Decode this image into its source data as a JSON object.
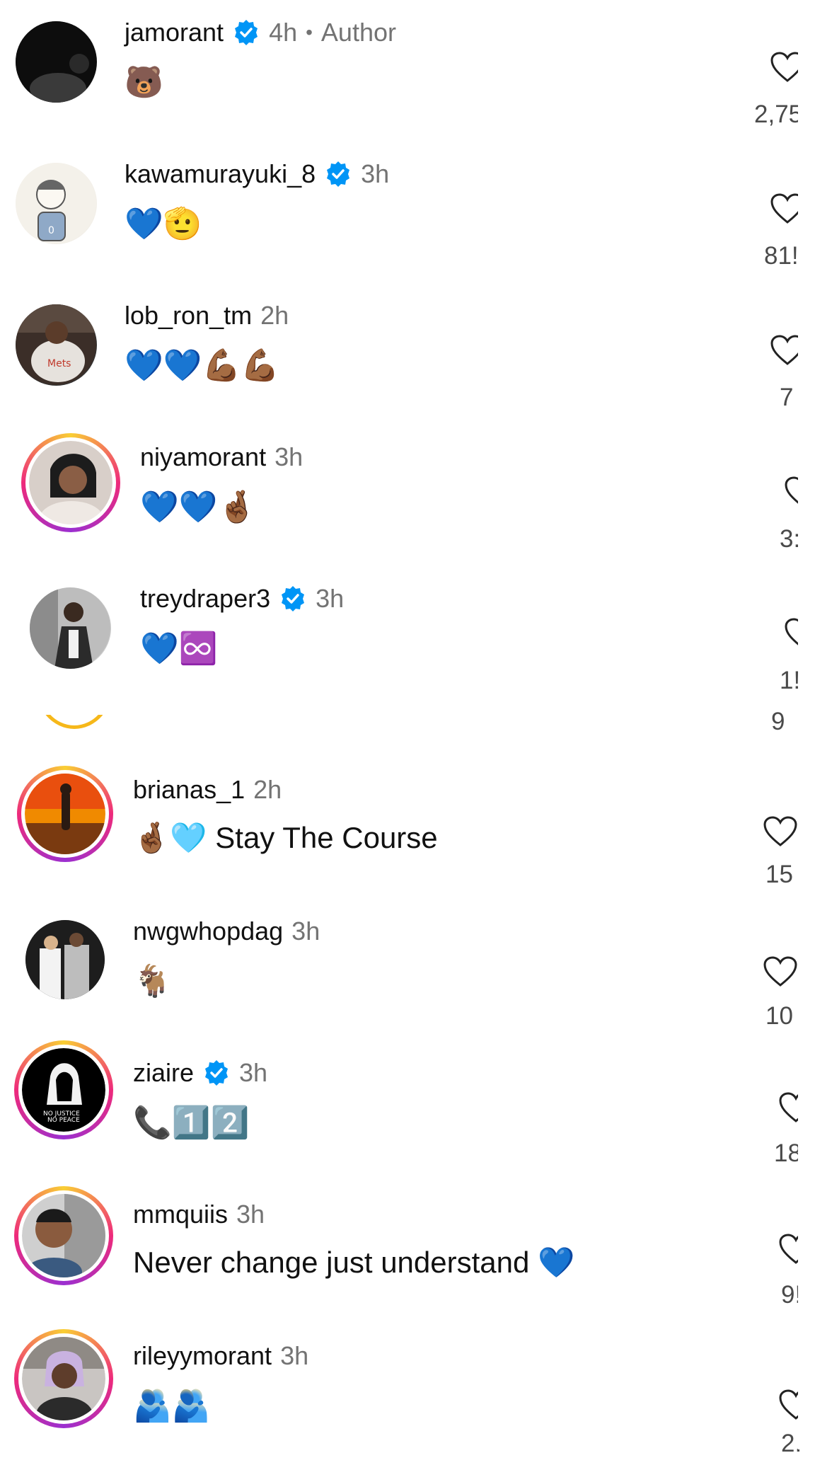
{
  "comments": [
    {
      "username": "jamorant",
      "verified": true,
      "time": "4h",
      "author_label": "Author",
      "text": "🐻",
      "likes": "2,75"
    },
    {
      "username": "kawamurayuki_8",
      "verified": true,
      "time": "3h",
      "text": "💙🫡",
      "likes": "81!"
    },
    {
      "username": "lob_ron_tm",
      "verified": false,
      "time": "2h",
      "text": "💙💙💪🏾💪🏾",
      "likes": "7"
    },
    {
      "username": "niyamorant",
      "verified": false,
      "time": "3h",
      "text": "💙💙🤞🏾",
      "likes": "3:"
    },
    {
      "username": "treydraper3",
      "verified": true,
      "time": "3h",
      "text": "💙♾️",
      "likes": "1!"
    },
    {
      "username": "brianas_1",
      "verified": false,
      "time": "2h",
      "text": "🤞🏾🩵 Stay The Course",
      "likes": "15"
    },
    {
      "username": "nwgwhopdag",
      "verified": false,
      "time": "3h",
      "text": "🐐",
      "likes": "10"
    },
    {
      "username": "ziaire",
      "verified": true,
      "time": "3h",
      "text": "📞1️⃣2️⃣",
      "likes": "18"
    },
    {
      "username": "mmquiis",
      "verified": false,
      "time": "3h",
      "text": "Never change just understand 💙",
      "likes": "9!"
    },
    {
      "username": "rileyymorant",
      "verified": false,
      "time": "3h",
      "text": "🫂🫂",
      "likes": "2."
    }
  ],
  "stray_count": "9",
  "colors": {
    "verified_badge": "#0095f6",
    "story_ring": "#ee2a7b",
    "meta_gray": "#737373"
  }
}
